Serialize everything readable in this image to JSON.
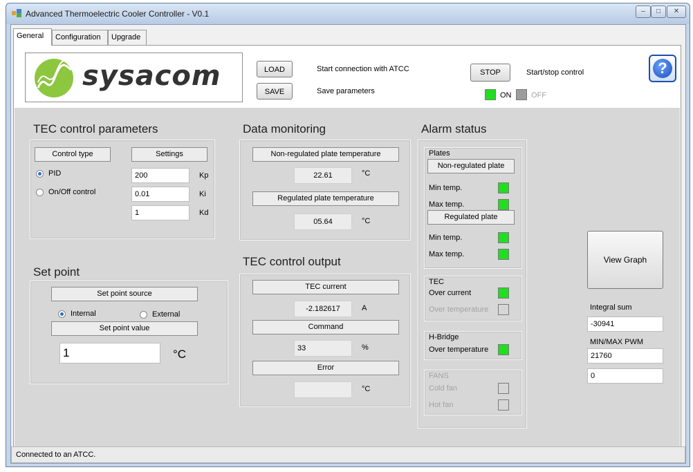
{
  "window": {
    "title": "Advanced Thermoelectric Cooler Controller - V0.1"
  },
  "tabs": [
    "General",
    "Configuration",
    "Upgrade"
  ],
  "logo": {
    "text": "sysacom"
  },
  "toolbar": {
    "load_label": "LOAD",
    "load_desc": "Start connection with ATCC",
    "save_label": "SAVE",
    "save_desc": "Save parameters",
    "stop_label": "STOP",
    "stop_desc": "Start/stop control",
    "on_label": "ON",
    "off_label": "OFF",
    "help_icon": "question-mark"
  },
  "tec_params": {
    "title": "TEC control parameters",
    "control_type_label": "Control type",
    "settings_label": "Settings",
    "pid_label": "PID",
    "onoff_label": "On/Off control",
    "kp_value": "200",
    "kp_label": "Kp",
    "ki_value": "0.01",
    "ki_label": "Ki",
    "kd_value": "1",
    "kd_label": "Kd"
  },
  "set_point": {
    "title": "Set point",
    "source_label": "Set point source",
    "internal_label": "Internal",
    "external_label": "External",
    "value_label": "Set point value",
    "value": "1",
    "unit": "°C"
  },
  "monitoring": {
    "title": "Data monitoring",
    "nonreg_label": "Non-regulated plate temperature",
    "nonreg_value": "22.61",
    "nonreg_unit": "°C",
    "reg_label": "Regulated plate temperature",
    "reg_value": "05.64",
    "reg_unit": "°C"
  },
  "tec_output": {
    "title": "TEC control output",
    "current_label": "TEC current",
    "current_value": "-2.182617",
    "current_unit": "A",
    "command_label": "Command",
    "command_value": "33",
    "command_unit": "%",
    "error_label": "Error",
    "error_value": "",
    "error_unit": "°C"
  },
  "alarm": {
    "title": "Alarm status",
    "plates_label": "Plates",
    "nonreg_plate_label": "Non-regulated plate",
    "reg_plate_label": "Regulated plate",
    "min_temp": "Min temp.",
    "max_temp": "Max temp.",
    "tec_label": "TEC",
    "over_current": "Over current",
    "over_temperature_tec": "Over temperature",
    "hbridge_label": "H-Bridge",
    "over_temperature_hb": "Over temperature",
    "fans_label": "FANS",
    "cold_fan": "Cold fan",
    "hot_fan": "Hot fan",
    "colors": {
      "on": "#22dd22",
      "off": "#d6d6d6"
    }
  },
  "right_panel": {
    "view_graph_label": "View Graph",
    "integral_sum_label": "Integral sum",
    "integral_sum_value": "-30941",
    "minmax_label": "MIN/MAX PWM",
    "minmax_value": "21760",
    "extra_value": "0"
  },
  "statusbar": {
    "text": "Connected to an ATCC."
  }
}
